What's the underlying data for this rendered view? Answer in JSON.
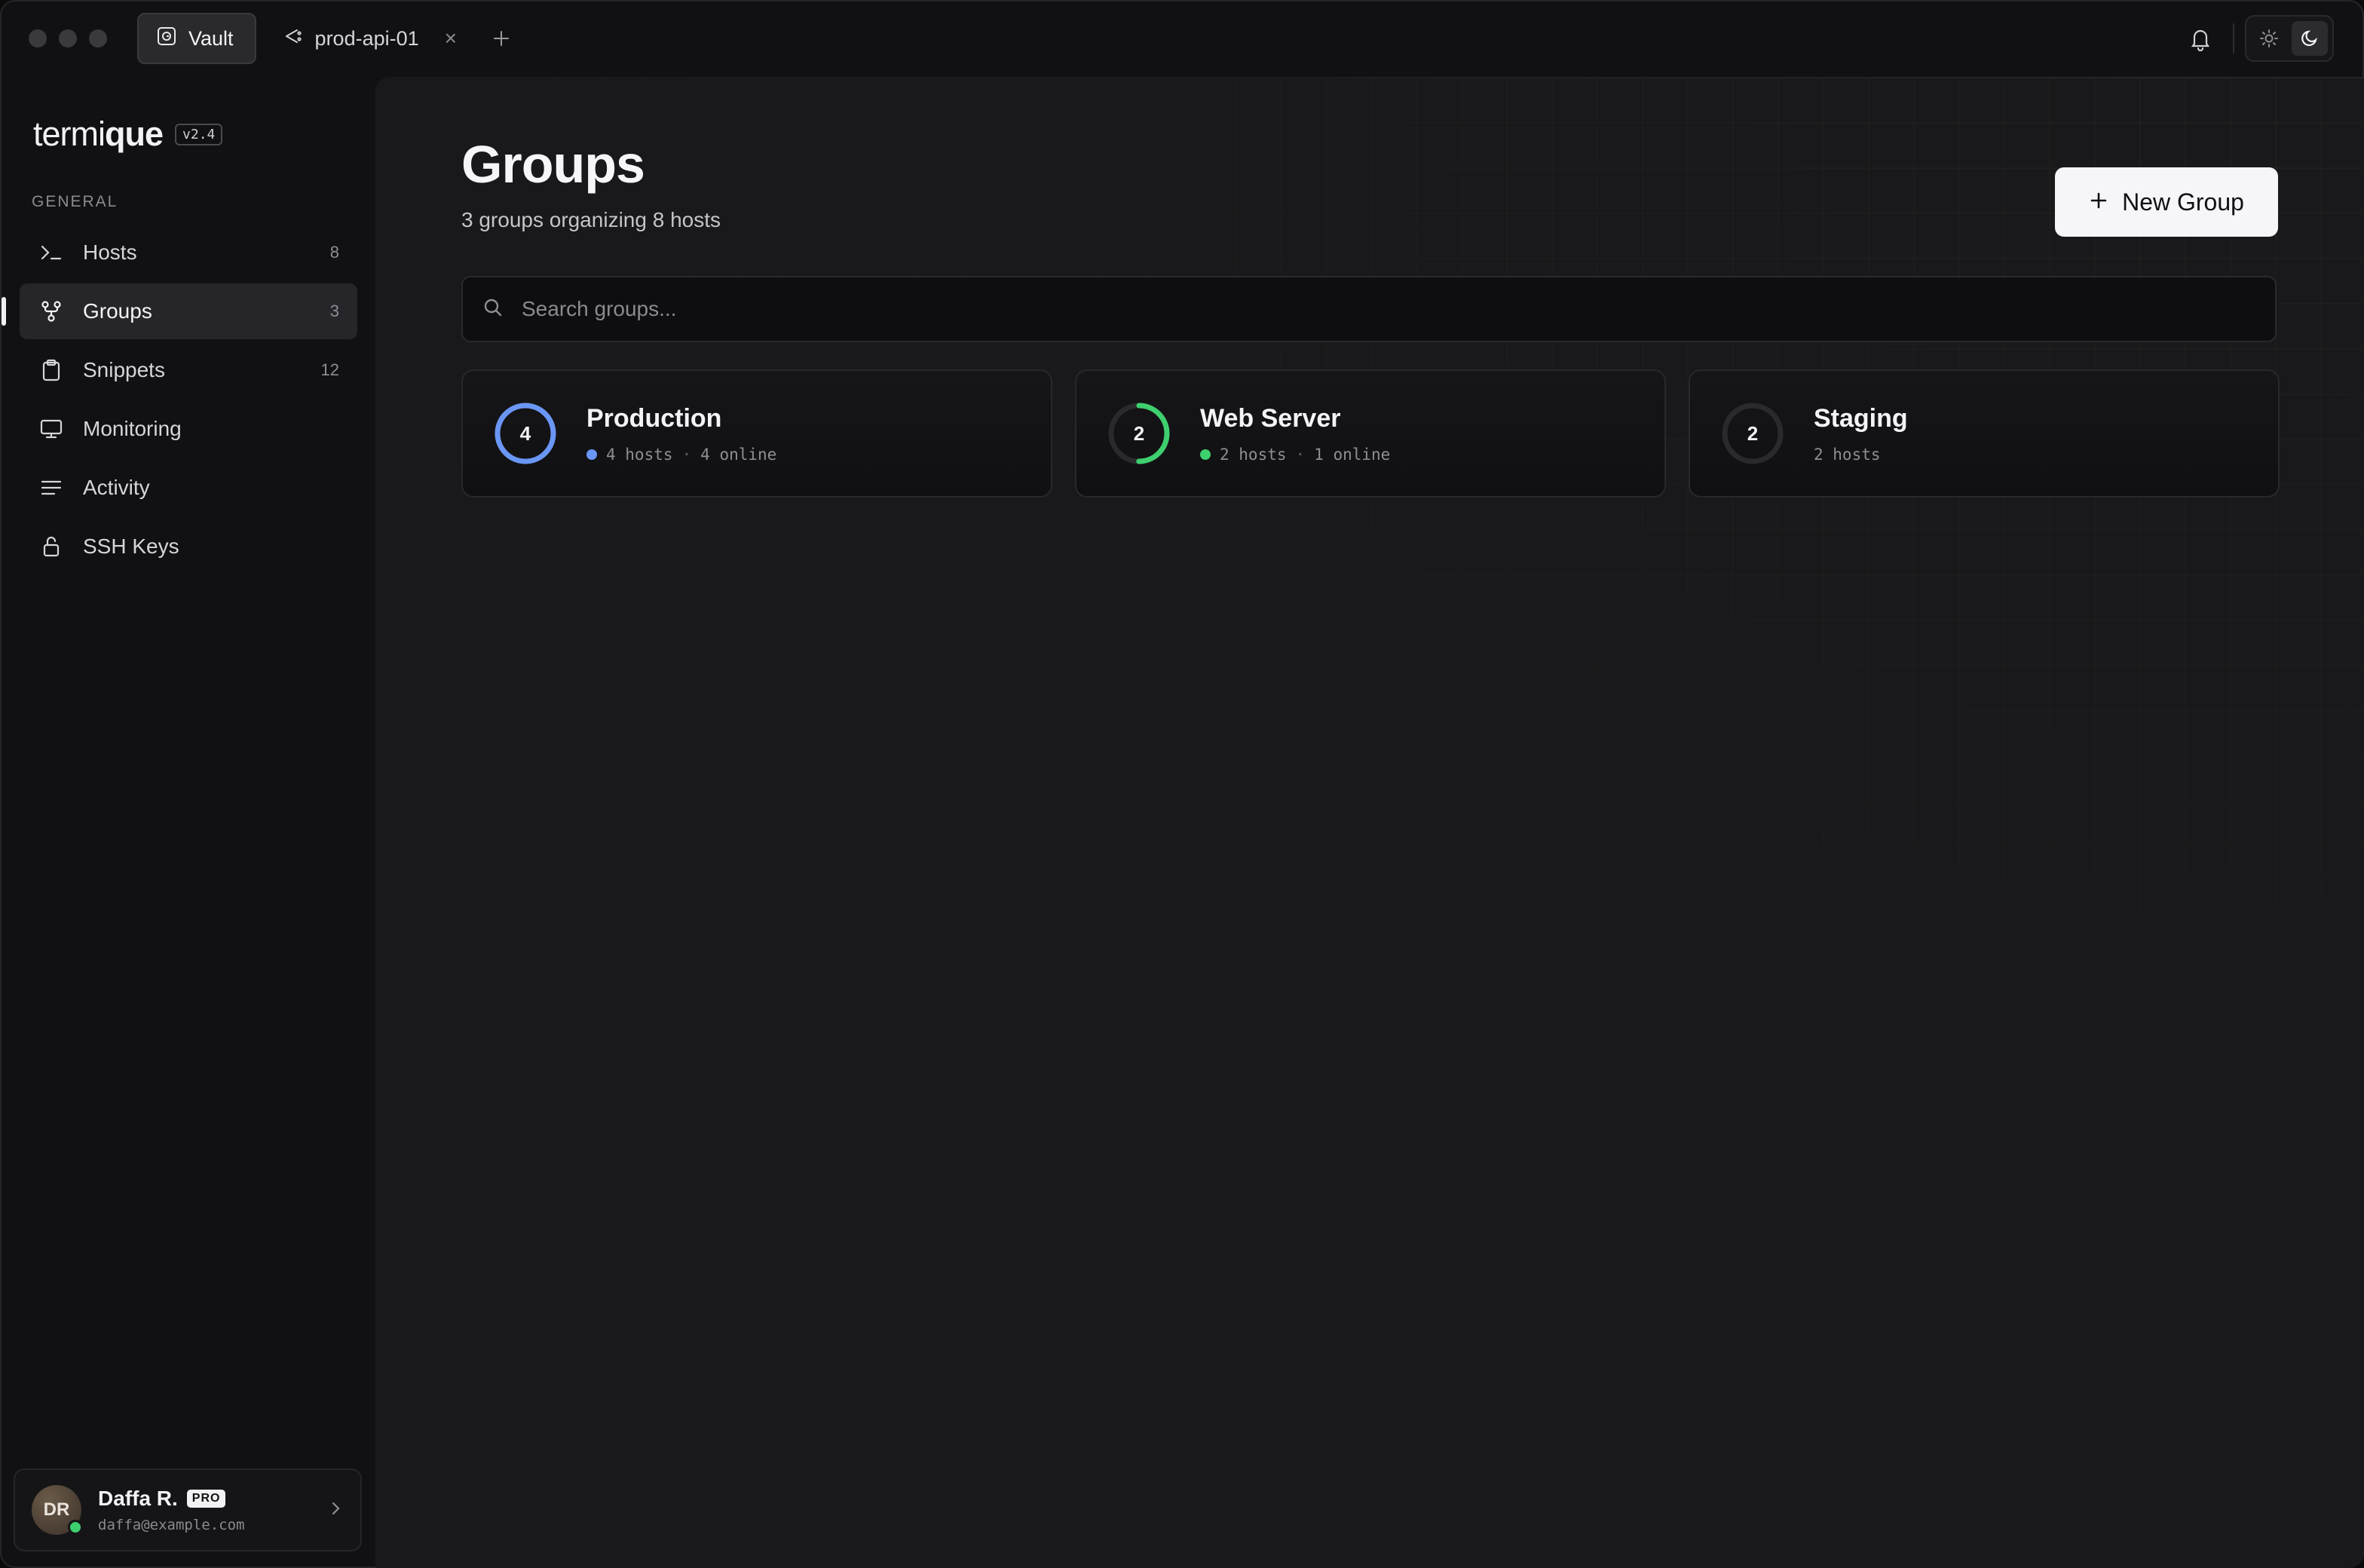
{
  "titlebar": {
    "tabs": [
      {
        "label": "Vault",
        "icon": "vault-icon",
        "active": true
      },
      {
        "label": "prod-api-01",
        "icon": "ssh-terminal-icon",
        "active": false,
        "closable": true
      }
    ],
    "close_glyph": "×"
  },
  "sidebar": {
    "brand_prefix": "termi",
    "brand_suffix": "que",
    "version": "v2.4",
    "section_label": "GENERAL",
    "items": [
      {
        "label": "Hosts",
        "count": "8",
        "icon": "terminal-prompt-icon"
      },
      {
        "label": "Groups",
        "count": "3",
        "icon": "branch-icon",
        "active": true
      },
      {
        "label": "Snippets",
        "count": "12",
        "icon": "clipboard-icon"
      },
      {
        "label": "Monitoring",
        "count": "",
        "icon": "monitor-icon"
      },
      {
        "label": "Activity",
        "count": "",
        "icon": "list-lines-icon"
      },
      {
        "label": "SSH Keys",
        "count": "",
        "icon": "lock-icon"
      }
    ],
    "user": {
      "initials": "DR",
      "name": "Daffa R.",
      "badge": "PRO",
      "email": "daffa@example.com"
    }
  },
  "main": {
    "title": "Groups",
    "subtitle": "3 groups organizing 8 hosts",
    "new_button_label": "New Group",
    "search_placeholder": "Search groups...",
    "groups": [
      {
        "name": "Production",
        "count": "4",
        "hosts": "4 hosts",
        "online": "4 online",
        "online_fraction": 1.0,
        "accent": "#6a96f5"
      },
      {
        "name": "Web Server",
        "count": "2",
        "hosts": "2 hosts",
        "online": "1 online",
        "online_fraction": 0.5,
        "accent": "#3ecf6e"
      },
      {
        "name": "Staging",
        "count": "2",
        "hosts": "2 hosts",
        "online": "",
        "online_fraction": 0,
        "accent": "#3a3a3e"
      }
    ],
    "meta_separator": "·"
  },
  "colors": {
    "accent_blue": "#6a96f5",
    "accent_green": "#3ecf6e",
    "background": "#111113"
  }
}
